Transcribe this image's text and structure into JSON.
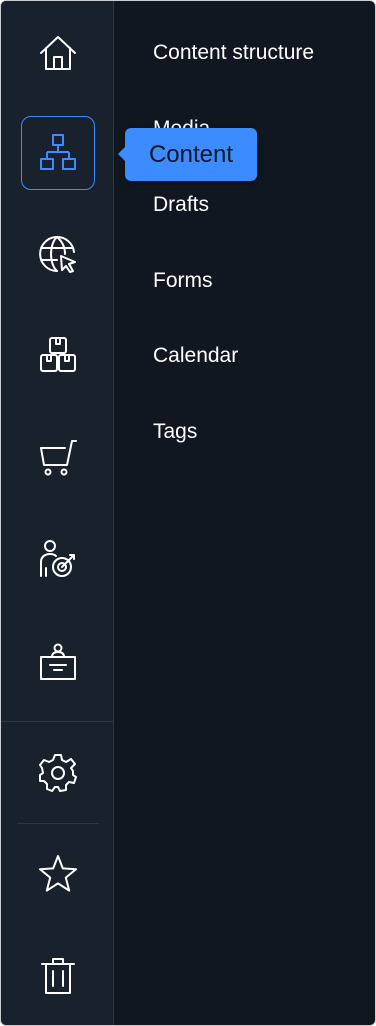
{
  "tooltip": {
    "text": "Content"
  },
  "rail": {
    "items": [
      {
        "icon": "home-icon",
        "active": false
      },
      {
        "icon": "sitemap-icon",
        "active": true
      },
      {
        "icon": "globe-cursor-icon",
        "active": false
      },
      {
        "icon": "boxes-icon",
        "active": false
      },
      {
        "icon": "shopping-cart-icon",
        "active": false
      },
      {
        "icon": "person-target-icon",
        "active": false
      },
      {
        "icon": "reception-desk-icon",
        "active": false
      },
      {
        "icon": "gear-icon",
        "active": false
      },
      {
        "icon": "star-icon",
        "active": false
      },
      {
        "icon": "trash-icon",
        "active": false
      }
    ]
  },
  "menu": {
    "items": [
      {
        "label": "Content structure"
      },
      {
        "label": "Media"
      },
      {
        "label": "Drafts"
      },
      {
        "label": "Forms"
      },
      {
        "label": "Calendar"
      },
      {
        "label": "Tags"
      }
    ]
  },
  "colors": {
    "rail_bg": "#19212c",
    "panel_bg": "#111720",
    "accent": "#3d8cff",
    "text": "#ffffff",
    "divider": "#1f3a5c"
  }
}
